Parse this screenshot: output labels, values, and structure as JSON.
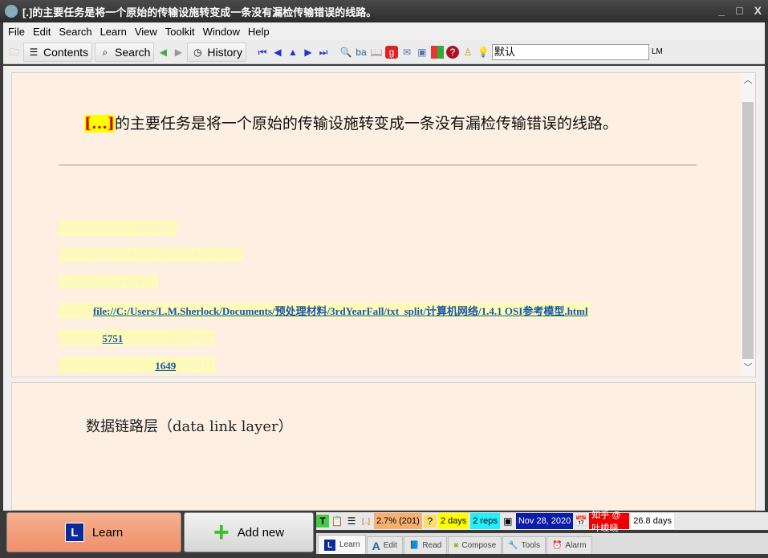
{
  "window": {
    "title": "[.]的主要任务是将一个原始的传输设施转变成一条没有漏检传输错误的线路。",
    "min": "_",
    "max": "□",
    "close": "X"
  },
  "menu": [
    "File",
    "Edit",
    "Search",
    "Learn",
    "View",
    "Toolkit",
    "Window",
    "Help"
  ],
  "toolbar": {
    "contents": "Contents",
    "search": "Search",
    "history": "History",
    "input_value": "默认",
    "lm": "LM"
  },
  "question": {
    "cloze": "[...]",
    "text": "的主要任务是将一个原始的传输设施转变成一条没有漏检传输错误的线路。"
  },
  "references": {
    "title": "#Title: 1.4.1 OSI参考模型",
    "date": "#Date: Imported on 11/17/2020, 12:01:00",
    "source": "#Source: Web Import",
    "link_label": "#Link:",
    "link": "file://C:/Users/L.M.Sherlock/Documents/预处理材料/3rdYearFall/txt_split/计算机网络/1.4.1 OSI参考模型.html",
    "article_label": "#Article:",
    "article_id": "5751",
    "article_rest": ": 1.4.1 OSI参考模型",
    "concept_label": "#Concept group: (...)",
    "concept_id": "1649",
    "concept_rest": ": 计算机"
  },
  "answer": "数据链路层（data link layer）",
  "buttons": {
    "learn": "Learn",
    "add_new": "Add new"
  },
  "status": {
    "priority": "2.7%",
    "priority_count": "(201)",
    "interval": "2 days",
    "reps": "2 reps",
    "date": "Nov 28, 2020",
    "days": "26.8 days",
    "watermark": "知乎 @叶峻峣"
  },
  "tabs": [
    "Learn",
    "Edit",
    "Read",
    "Compose",
    "Tools",
    "Alarm"
  ]
}
